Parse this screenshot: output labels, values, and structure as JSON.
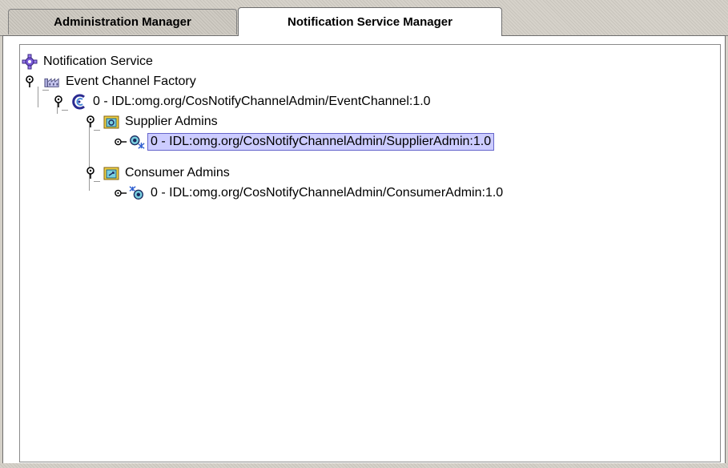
{
  "tabs": [
    {
      "label": "Administration Manager",
      "active": false
    },
    {
      "label": "Notification Service Manager",
      "active": true
    }
  ],
  "tree": {
    "root": {
      "label": "Notification Service",
      "icon": "notification-service-icon"
    },
    "factory": {
      "label": "Event Channel Factory",
      "icon": "factory-icon"
    },
    "channel": {
      "label": "0 - IDL:omg.org/CosNotifyChannelAdmin/EventChannel:1.0",
      "icon": "event-channel-icon"
    },
    "supplier_admins": {
      "label": "Supplier Admins",
      "icon": "folder-icon"
    },
    "supplier_admin": {
      "label": "0 - IDL:omg.org/CosNotifyChannelAdmin/SupplierAdmin:1.0",
      "icon": "supplier-admin-icon",
      "selected": true
    },
    "consumer_admins": {
      "label": "Consumer Admins",
      "icon": "folder-icon"
    },
    "consumer_admin": {
      "label": "0 - IDL:omg.org/CosNotifyChannelAdmin/ConsumerAdmin:1.0",
      "icon": "consumer-admin-icon"
    }
  },
  "colors": {
    "selection": "#ccccff",
    "selection_border": "#6666cc"
  }
}
